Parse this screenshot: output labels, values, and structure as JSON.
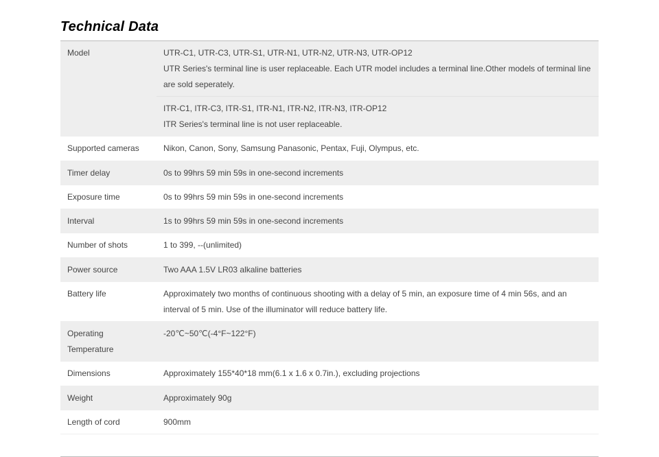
{
  "title": "Technical Data",
  "rows": {
    "model": {
      "label": "Model",
      "utr": "UTR-C1, UTR-C3, UTR-S1, UTR-N1, UTR-N2, UTR-N3, UTR-OP12",
      "utr_note": "UTR Series's terminal line is user replaceable. Each UTR model includes a terminal line.Other models of terminal line are sold seperately.",
      "itr": "ITR-C1, ITR-C3, ITR-S1, ITR-N1, ITR-N2, ITR-N3, ITR-OP12",
      "itr_note": "ITR Series's terminal line is not user replaceable."
    },
    "supported_cameras": {
      "label": "Supported cameras",
      "value": "Nikon, Canon, Sony, Samsung Panasonic, Pentax, Fuji, Olympus, etc."
    },
    "timer_delay": {
      "label": "Timer delay",
      "value": "0s to 99hrs 59 min 59s in one-second increments"
    },
    "exposure_time": {
      "label": "Exposure time",
      "value": "0s to 99hrs 59 min 59s in one-second increments"
    },
    "interval": {
      "label": "Interval",
      "value": "1s to 99hrs 59 min 59s in one-second increments"
    },
    "number_of_shots": {
      "label": "Number of shots",
      "value": "1 to 399,   --(unlimited)"
    },
    "power_source": {
      "label": "Power source",
      "value": "Two AAA 1.5V LR03 alkaline batteries"
    },
    "battery_life": {
      "label": "Battery life",
      "value": "Approximately two months of continuous shooting with a delay of 5 min, an exposure time of 4 min 56s, and an interval of 5 min. Use of the illuminator will reduce battery life."
    },
    "operating_temp": {
      "label": "Operating Temperature",
      "value": "-20℃~50℃(-4°F~122°F)"
    },
    "dimensions": {
      "label": "Dimensions",
      "value": "Approximately 155*40*18 mm(6.1 x 1.6 x 0.7in.), excluding projections"
    },
    "weight": {
      "label": "Weight",
      "value": "Approximately 90g"
    },
    "length_of_cord": {
      "label": "Length of cord",
      "value": "900mm"
    }
  }
}
